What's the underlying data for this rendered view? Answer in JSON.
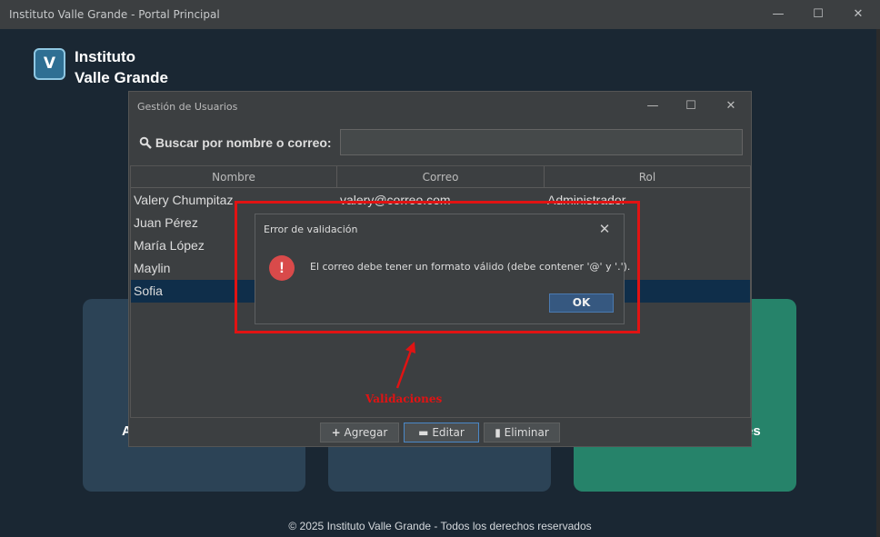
{
  "window": {
    "title": "Instituto Valle Grande - Portal Principal",
    "minimize_glyph": "—",
    "maximize_glyph": "☐",
    "close_glyph": "✕"
  },
  "brand": {
    "logo_letter": "V",
    "name_line1": "Instituto",
    "name_line2": "Valle Grande"
  },
  "cards": [
    {
      "label": "A",
      "color": "#2c4356"
    },
    {
      "label": "",
      "color": "#2c4356"
    },
    {
      "label": "tes",
      "color": "#26836a"
    }
  ],
  "footer": "© 2025 Instituto Valle Grande - Todos los derechos reservados",
  "user_mgmt": {
    "title": "Gestión de Usuarios",
    "search_label": "Buscar por nombre o correo:",
    "search_value": "",
    "columns": [
      "Nombre",
      "Correo",
      "Rol"
    ],
    "rows": [
      {
        "name": "Valery Chumpitaz",
        "email": "valery@correo.com",
        "role": "Administrador"
      },
      {
        "name": "Juan Pérez",
        "email": "",
        "role": ""
      },
      {
        "name": "María López",
        "email": "",
        "role": ""
      },
      {
        "name": "Maylin",
        "email": "",
        "role": ""
      },
      {
        "name": "Sofia",
        "email": "",
        "role": ""
      }
    ],
    "selected_row": 4,
    "buttons": {
      "add": "Agregar",
      "edit": "Editar",
      "delete": "Eliminar"
    }
  },
  "dialog": {
    "title": "Error de validación",
    "message": "El correo debe tener un formato válido (debe contener '@' y '.').",
    "ok": "OK",
    "icon": "error-icon"
  },
  "annotation": {
    "label": "Validaciones",
    "color": "#e11313"
  },
  "colors": {
    "background": "#1a2733",
    "accent": "#365880",
    "selection": "#0f2e4a"
  }
}
